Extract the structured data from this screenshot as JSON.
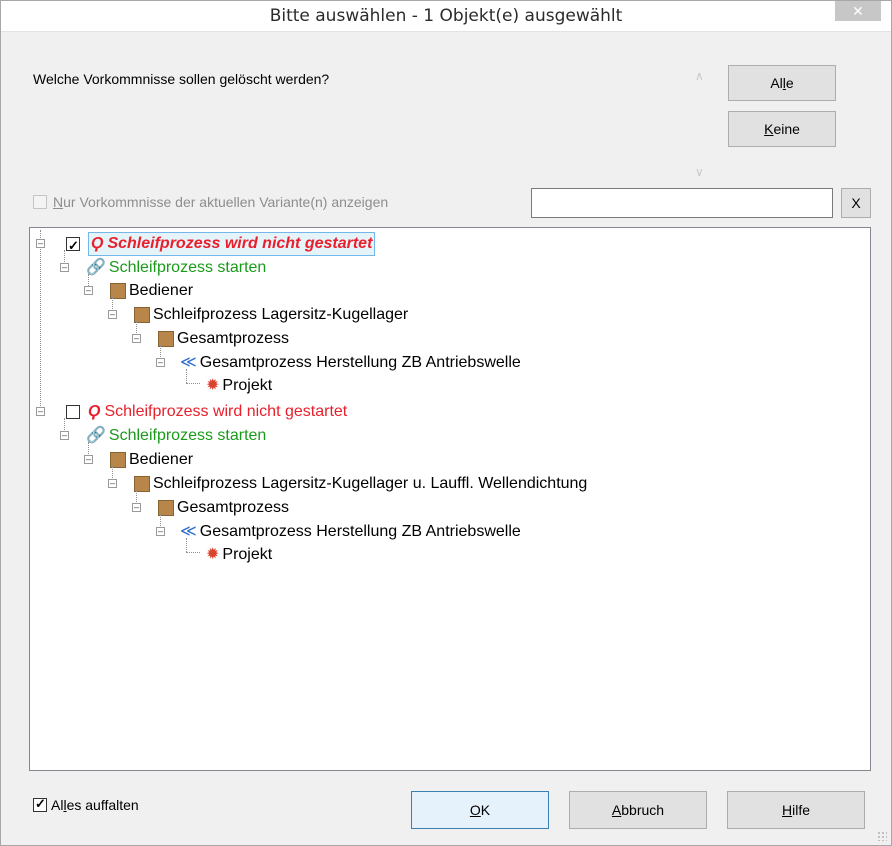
{
  "window": {
    "title": "Bitte auswählen - 1 Objekt(e) ausgewählt",
    "close_glyph": "✕"
  },
  "question": "Welche Vorkommnisse sollen gelöscht werden?",
  "buttons": {
    "alle": "Alle",
    "keine": "Keine",
    "x": "X",
    "ok": "OK",
    "abbruch": "Abbruch",
    "hilfe": "Hilfe"
  },
  "filter": {
    "checkbox_label": "Nur Vorkommnisse der aktuellen Variante(n) anzeigen",
    "checked": false,
    "disabled": true,
    "value": ""
  },
  "expand_all": {
    "label": "Alles auffalten",
    "checked": true
  },
  "tree": [
    {
      "label": "Schleifprozess wird nicht gestartet",
      "icon": "lightning-icon",
      "color": "#e8202c",
      "checked": true,
      "selected": true,
      "children": [
        {
          "label": "Schleifprozess starten",
          "icon": "link-icon",
          "color": "#1a9a1a"
        },
        {
          "label": "Bediener",
          "icon": "square-icon"
        },
        {
          "label": "Schleifprozess Lagersitz-Kugellager",
          "icon": "square-icon"
        },
        {
          "label": "Gesamtprozess",
          "icon": "square-icon"
        },
        {
          "label": "Gesamtprozess Herstellung ZB Antriebswelle",
          "icon": "structure-icon"
        },
        {
          "label": "Projekt",
          "icon": "gear-icon"
        }
      ]
    },
    {
      "label": "Schleifprozess wird nicht gestartet",
      "icon": "lightning-icon",
      "color": "#e8202c",
      "checked": false,
      "selected": false,
      "children": [
        {
          "label": "Schleifprozess starten",
          "icon": "link-icon",
          "color": "#1a9a1a"
        },
        {
          "label": "Bediener",
          "icon": "square-icon"
        },
        {
          "label": "Schleifprozess Lagersitz-Kugellager u. Lauffl. Wellendichtung",
          "icon": "square-icon"
        },
        {
          "label": "Gesamtprozess",
          "icon": "square-icon"
        },
        {
          "label": "Gesamtprozess Herstellung ZB Antriebswelle",
          "icon": "structure-icon"
        },
        {
          "label": "Projekt",
          "icon": "gear-icon"
        }
      ]
    }
  ]
}
